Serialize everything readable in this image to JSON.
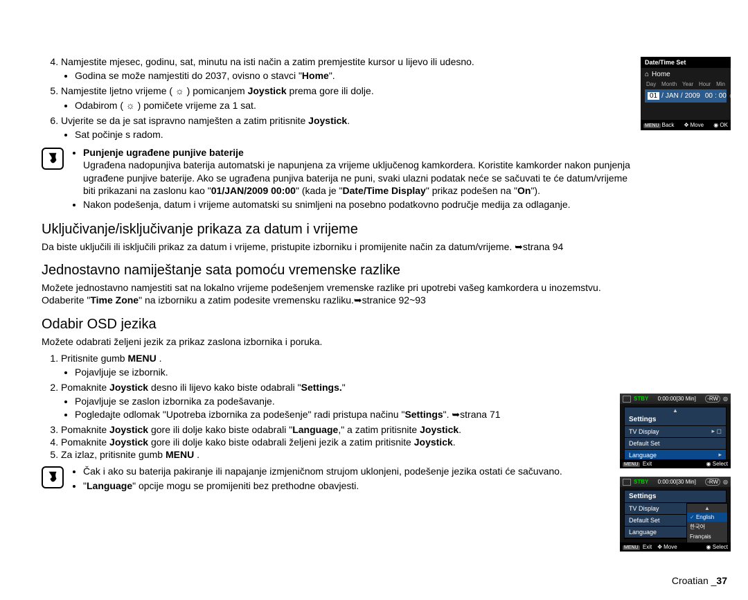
{
  "top_list": {
    "i4": {
      "main": "Namjestite mjesec, godinu, sat, minutu na isti način a zatim premjestite kursor u lijevo ili udesno.",
      "sub1_pre": "Godina se može namjestiti do 2037, ovisno o stavci \"",
      "sub1_bold": "Home",
      "sub1_post": "\"."
    },
    "i5": {
      "main_pre": "Namjestite ljetno vrijeme ( ",
      "main_mid": " ) pomicanjem ",
      "main_bold": "Joystick",
      "main_post": " prema gore ili dolje.",
      "sub1_pre": "Odabirom ( ",
      "sub1_post": " ) pomičete vrijeme za 1 sat."
    },
    "i6": {
      "main_pre": "Uvjerite se da je sat ispravno namješten a zatim pritisnite ",
      "main_bold": "Joystick",
      "main_post": ".",
      "sub1": "Sat počinje s radom."
    }
  },
  "note1": {
    "b1": "Punjenje ugrađene punjive baterije",
    "p1_pre": "Ugrađena nadopunjiva baterija automatski je napunjena za vrijeme uključenog kamkordera. Koristite kamkorder nakon punjenja ugrađene punjive baterije. Ako se ugrađena punjiva baterija ne puni, svaki ulazni podatak neće se sačuvati te će datum/vrijeme biti prikazani na zaslonu kao \"",
    "p1_b1": "01/JAN/2009 00:00",
    "p1_mid": "\" (kada je \"",
    "p1_b2": "Date/Time Display",
    "p1_mid2": "\" prikaz podešen na \"",
    "p1_b3": "On",
    "p1_post": "\").",
    "p2": "Nakon podešenja, datum i vrijeme automatski su snimljeni na posebno podatkovno područje medija za odlaganje."
  },
  "h2a": "Uključivanje/isključivanje prikaza za datum i vrijeme",
  "p2a": "Da biste uključili ili isključili prikaz za datum i vrijeme, pristupite izborniku i promijenite način za datum/vrijeme. ➥strana 94",
  "h2b": "Jednostavno namiještanje sata pomoću vremenske razlike",
  "p2b_pre": "Možete jednostavno namjestiti sat na lokalno vrijeme podešenjem vremenske razlike pri upotrebi vašeg kamkordera u inozemstvu. Odaberite \"",
  "p2b_bold": "Time Zone",
  "p2b_post": "\" na izborniku a zatim podesite vremensku razliku.➥stranice 92~93",
  "h2c": "Odabir OSD jezika",
  "p2c": "Možete odabrati željeni jezik za prikaz zaslona izbornika i poruka.",
  "osd_list": {
    "i1": {
      "pre": "Pritisnite gumb ",
      "b": "MENU",
      "post": " .",
      "sub": "Pojavljuje se izbornik."
    },
    "i2": {
      "pre": "Pomaknite ",
      "b": "Joystick",
      "mid": " desno ili lijevo kako biste odabrali \"",
      "b2": "Settings.",
      "post": "\"",
      "sub1": "Pojavljuje se zaslon izbornika za podešavanje.",
      "sub2_pre": "Pogledajte odlomak \"Upotreba izbornika za podešenje\" radi pristupa načinu \"",
      "sub2_b": "Settings",
      "sub2_post": "\". ➥strana 71"
    },
    "i3": {
      "pre": "Pomaknite ",
      "b": "Joystick",
      "mid": " gore ili dolje kako biste odabrali \"",
      "b2": "Language",
      "post": ",\" a zatim pritisnite ",
      "b3": "Joystick",
      "post2": "."
    },
    "i4": {
      "pre": "Pomaknite ",
      "b": "Joystick",
      "mid": " gore ili dolje kako biste odabrali željeni jezik a zatim pritisnite ",
      "b2": "Joystick",
      "post": "."
    },
    "i5": {
      "pre": "Za izlaz, pritisnite gumb ",
      "b": "MENU",
      "post": " ."
    }
  },
  "note2": {
    "p1": "Čak i ako su baterija pakiranje ili napajanje izmjeničnom strujom uklonjeni, podešenje jezika ostati će sačuvano.",
    "p2_pre": "\"",
    "p2_b": "Language",
    "p2_post": "\" opcije mogu se promijeniti bez prethodne obavjesti."
  },
  "scr1": {
    "title": "Date/Time Set",
    "home": "Home",
    "cols": [
      "Day",
      "Month",
      "Year",
      "Hour",
      "Min"
    ],
    "day": "01",
    "month": "JAN",
    "year": "2009",
    "hour": "00",
    "min": "00",
    "back": "Back",
    "move": "Move",
    "ok": "OK",
    "menu": "MENU"
  },
  "scr2": {
    "stby": "STBY",
    "time": "0:00:00[30 Min]",
    "rw": "-RW",
    "title": "Settings",
    "rows": [
      "TV Display",
      "Default Set",
      "Language"
    ],
    "menu": "MENU",
    "exit": "Exit",
    "select": "Select"
  },
  "scr3": {
    "stby": "STBY",
    "time": "0:00:00[30 Min]",
    "rw": "-RW",
    "title": "Settings",
    "rows": [
      "TV Display",
      "Default Set",
      "Language"
    ],
    "langs": [
      "English",
      "한국어",
      "Français"
    ],
    "menu": "MENU",
    "exit": "Exit",
    "move": "Move",
    "select": "Select"
  },
  "footer": {
    "lang": "Croatian _",
    "page": "37"
  }
}
